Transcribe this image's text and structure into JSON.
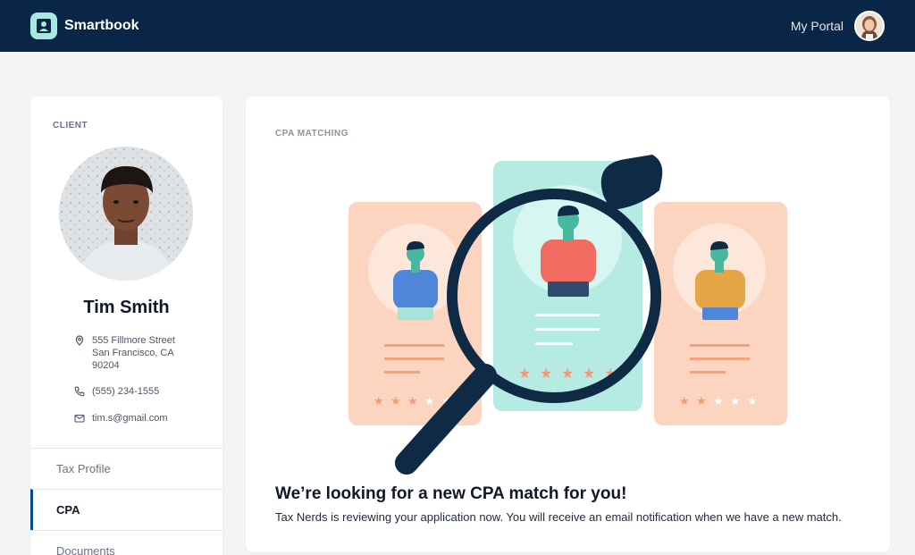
{
  "header": {
    "brand": "Smartbook",
    "portal_label": "My Portal"
  },
  "sidebar": {
    "section_label": "CLIENT",
    "client_name": "Tim Smith",
    "address_line1": "555 Fillmore Street",
    "address_line2": "San Francisco, CA",
    "address_line3": "90204",
    "phone": "(555) 234-1555",
    "email": "tim.s@gmail.com",
    "nav": [
      {
        "label": "Tax Profile",
        "active": false
      },
      {
        "label": "CPA",
        "active": true
      },
      {
        "label": "Documents",
        "active": false
      }
    ]
  },
  "main": {
    "section_label": "CPA MATCHING",
    "headline": "We’re looking for a new CPA match for you!",
    "subtext": "Tax Nerds is reviewing your application now. You will receive an email notification when we have a new match."
  },
  "colors": {
    "topbar": "#0a2647",
    "accent": "#0a4b8c",
    "card_peach": "#fcd5c0",
    "card_mint": "#b6ebe4",
    "star": "#f39b74"
  },
  "icons": [
    "logo-icon",
    "location-pin-icon",
    "phone-icon",
    "mail-icon",
    "magnifier-icon",
    "star-icon"
  ]
}
